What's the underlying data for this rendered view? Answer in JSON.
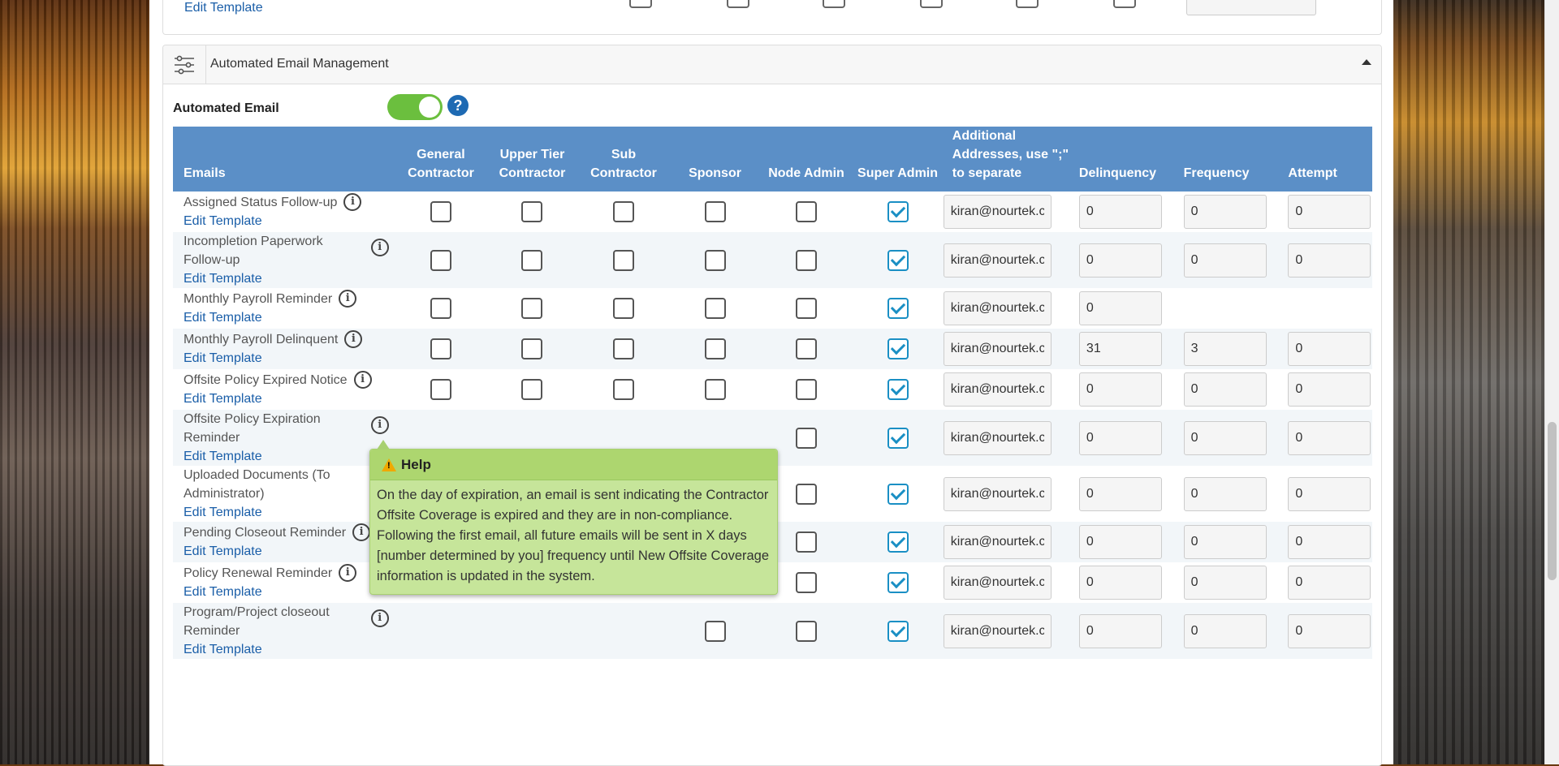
{
  "previous_section": {
    "edit_template": "Edit Template"
  },
  "section": {
    "title": "Automated Email Management",
    "automated_email_label": "Automated Email",
    "automated_email_enabled": true,
    "help_icon": "?"
  },
  "table": {
    "headers": {
      "emails": "Emails",
      "general": "General Contractor",
      "upper": "Upper Tier Contractor",
      "sub": "Sub Contractor",
      "sponsor": "Sponsor",
      "node": "Node Admin",
      "super": "Super Admin",
      "addr": "Additional Addresses, use \";\" to separate",
      "delinquency": "Delinquency",
      "frequency": "Frequency",
      "attempt": "Attempt"
    },
    "edit_template": "Edit Template",
    "rows": [
      {
        "name": "Assigned Status Follow-up",
        "gc": false,
        "utc": false,
        "sc": false,
        "sponsor": false,
        "node": false,
        "super": true,
        "addr": "kiran@nourtek.com",
        "delinquency": "0",
        "frequency": "0",
        "attempt": "0"
      },
      {
        "name": "Incompletion Paperwork Follow-up",
        "gc": false,
        "utc": false,
        "sc": false,
        "sponsor": false,
        "node": false,
        "super": true,
        "addr": "kiran@nourtek.com",
        "delinquency": "0",
        "frequency": "0",
        "attempt": "0"
      },
      {
        "name": "Monthly Payroll Reminder",
        "gc": false,
        "utc": false,
        "sc": false,
        "sponsor": false,
        "node": false,
        "super": true,
        "addr": "kiran@nourtek.com",
        "delinquency": "0"
      },
      {
        "name": "Monthly Payroll Delinquent",
        "gc": false,
        "utc": false,
        "sc": false,
        "sponsor": false,
        "node": false,
        "super": true,
        "addr": "kiran@nourtek.com",
        "delinquency": "31",
        "frequency": "3",
        "attempt": "0"
      },
      {
        "name": "Offsite Policy Expired Notice",
        "gc": false,
        "utc": false,
        "sc": false,
        "sponsor": false,
        "node": false,
        "super": true,
        "addr": "kiran@nourtek.com",
        "delinquency": "0",
        "frequency": "0",
        "attempt": "0"
      },
      {
        "name": "Offsite Policy Expiration Reminder",
        "node": false,
        "super": true,
        "addr": "kiran@nourtek.com",
        "delinquency": "0",
        "frequency": "0",
        "attempt": "0"
      },
      {
        "name": "Uploaded Documents (To Administrator)",
        "node": false,
        "super": true,
        "addr": "kiran@nourtek.com",
        "delinquency": "0",
        "frequency": "0",
        "attempt": "0"
      },
      {
        "name": "Pending Closeout Reminder",
        "gc": false,
        "utc": false,
        "sc": true,
        "sponsor": false,
        "node": false,
        "super": true,
        "addr": "kiran@nourtek.com",
        "delinquency": "0",
        "frequency": "0",
        "attempt": "0"
      },
      {
        "name": "Policy Renewal Reminder",
        "sponsor": false,
        "node": false,
        "super": true,
        "addr": "kiran@nourtek.com",
        "delinquency": "0",
        "frequency": "0",
        "attempt": "0"
      },
      {
        "name": "Program/Project closeout Reminder",
        "sponsor": false,
        "node": false,
        "super": true,
        "addr": "kiran@nourtek.com",
        "delinquency": "0",
        "frequency": "0",
        "attempt": "0"
      }
    ]
  },
  "popover": {
    "title": "Help",
    "body": "On the day of expiration, an email is sent indicating the Contractor Offsite Coverage is expired and they are in non-compliance. Following the first email, all future emails will be sent in X days [number determined by you] frequency until New Offsite Coverage information is updated in the system."
  },
  "colors": {
    "header_bg": "#5b8fc7",
    "toggle_on": "#6bbf3e",
    "link": "#1a5ea8",
    "popover_bg": "#c6e59a",
    "check": "#1a8fc4"
  }
}
